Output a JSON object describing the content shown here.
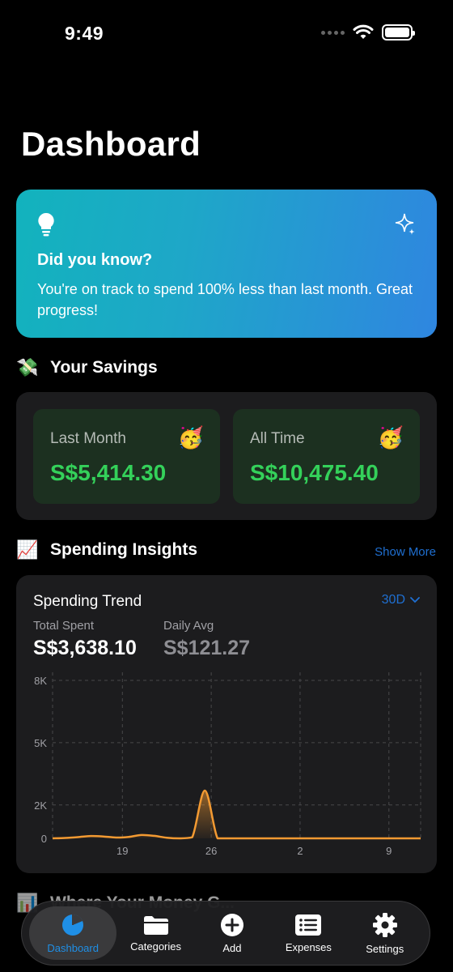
{
  "status_bar": {
    "time": "9:49"
  },
  "page": {
    "title": "Dashboard"
  },
  "tip": {
    "title": "Did you know?",
    "text": "You're on track to spend 100% less than last month. Great progress!",
    "icon": "lightbulb-icon",
    "accent_icon": "sparkles-icon"
  },
  "savings": {
    "heading": "Your Savings",
    "heading_emoji": "💸",
    "tiles": [
      {
        "label": "Last Month",
        "value": "S$5,414.30",
        "emoji": "🥳"
      },
      {
        "label": "All Time",
        "value": "S$10,475.40",
        "emoji": "🥳"
      }
    ],
    "value_color": "#34d15a"
  },
  "insights": {
    "heading": "Spending Insights",
    "heading_emoji": "📈",
    "show_more": "Show More",
    "trend_title": "Spending Trend",
    "range": "30D",
    "total_label": "Total Spent",
    "total_value": "S$3,638.10",
    "avg_label": "Daily Avg",
    "avg_value": "S$121.27"
  },
  "chart_data": {
    "type": "area",
    "title": "Spending Trend",
    "x_tick_labels": [
      "19",
      "26",
      "2",
      "9"
    ],
    "y_tick_labels": [
      "0",
      "2K",
      "5K",
      "8K"
    ],
    "ylim": [
      0,
      8000
    ],
    "grid": true,
    "line_color": "#f39a32",
    "x_days": [
      0,
      1,
      2,
      3,
      4,
      5,
      6,
      7,
      8,
      9,
      10,
      11,
      12,
      13,
      14,
      15,
      16,
      17,
      18,
      19,
      20,
      21,
      22,
      23,
      24,
      25,
      26,
      27,
      28,
      29
    ],
    "values": [
      0,
      20,
      60,
      110,
      90,
      40,
      70,
      160,
      120,
      30,
      0,
      50,
      2300,
      0,
      0,
      0,
      0,
      0,
      0,
      0,
      0,
      0,
      0,
      0,
      0,
      0,
      0,
      0,
      0,
      0
    ]
  },
  "next_section": {
    "heading": "Where Your Money G...",
    "emoji": "📊"
  },
  "tab_bar": {
    "tabs": [
      {
        "label": "Dashboard",
        "icon": "pie-chart-icon",
        "active": true
      },
      {
        "label": "Categories",
        "icon": "folder-icon",
        "active": false
      },
      {
        "label": "Add",
        "icon": "plus-circle-icon",
        "active": false
      },
      {
        "label": "Expenses",
        "icon": "list-icon",
        "active": false
      },
      {
        "label": "Settings",
        "icon": "gear-icon",
        "active": false
      }
    ]
  }
}
